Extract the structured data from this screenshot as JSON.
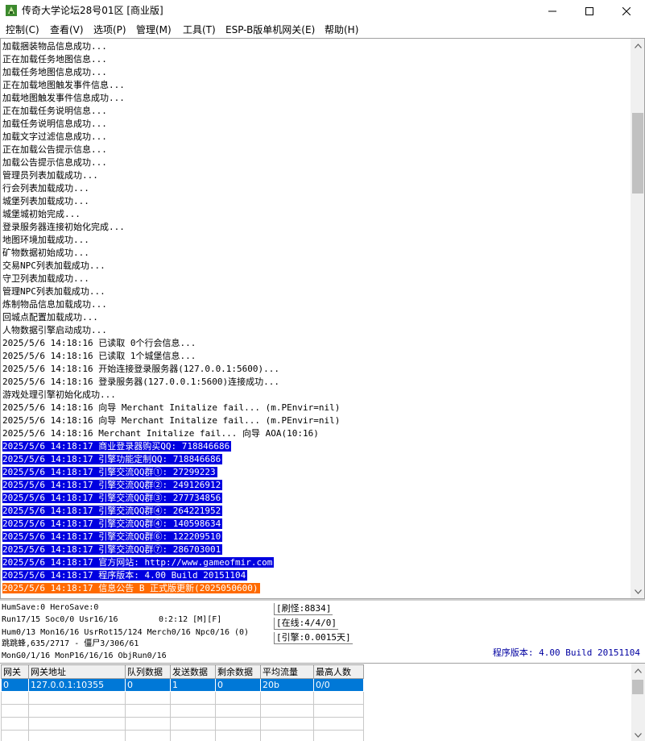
{
  "window": {
    "title": "传奇大学论坛28号01区 [商业版]"
  },
  "menu": [
    {
      "label": "控制(C)"
    },
    {
      "label": "查看(V)"
    },
    {
      "label": "选项(P)"
    },
    {
      "label": "管理(M)"
    },
    {
      "label": "工具(T)"
    },
    {
      "label": "ESP-B版单机网关(E)"
    },
    {
      "label": "帮助(H)"
    }
  ],
  "log": [
    {
      "text": "加载捆装物品信息成功..."
    },
    {
      "text": "正在加载任务地图信息..."
    },
    {
      "text": "加载任务地图信息成功..."
    },
    {
      "text": "正在加载地图触发事件信息..."
    },
    {
      "text": "加载地图触发事件信息成功..."
    },
    {
      "text": "正在加载任务说明信息..."
    },
    {
      "text": "加载任务说明信息成功..."
    },
    {
      "text": "加载文字过滤信息成功..."
    },
    {
      "text": "正在加载公告提示信息..."
    },
    {
      "text": "加载公告提示信息成功..."
    },
    {
      "text": "管理员列表加载成功..."
    },
    {
      "text": "行会列表加载成功..."
    },
    {
      "text": "城堡列表加载成功..."
    },
    {
      "text": "城堡城初始完成..."
    },
    {
      "text": "登录服务器连接初始化完成..."
    },
    {
      "text": "地图环境加载成功..."
    },
    {
      "text": "矿物数据初始成功..."
    },
    {
      "text": "交易NPC列表加载成功..."
    },
    {
      "text": "守卫列表加载成功..."
    },
    {
      "text": "管理NPC列表加载成功..."
    },
    {
      "text": "炼制物品信息加载成功..."
    },
    {
      "text": "回城点配置加载成功..."
    },
    {
      "text": "人物数据引擎启动成功..."
    },
    {
      "text": "2025/5/6 14:18:16 已读取 0个行会信息..."
    },
    {
      "text": "2025/5/6 14:18:16 已读取 1个城堡信息..."
    },
    {
      "text": "2025/5/6 14:18:16 开始连接登录服务器(127.0.0.1:5600)..."
    },
    {
      "text": "2025/5/6 14:18:16 登录服务器(127.0.0.1:5600)连接成功..."
    },
    {
      "text": "游戏处理引擎初始化成功..."
    },
    {
      "text": "2025/5/6 14:18:16 向导 Merchant Initalize fail... (m.PEnvir=nil)"
    },
    {
      "text": "2025/5/6 14:18:16 向导 Merchant Initalize fail... (m.PEnvir=nil)"
    },
    {
      "text": "2025/5/6 14:18:16 Merchant Initalize fail... 向导 AOA(10:16)"
    },
    {
      "text": "2025/5/6 14:18:17 商业登录器购买QQ: 718846686",
      "hl": "blue"
    },
    {
      "text": "2025/5/6 14:18:17 引擎功能定制QQ: 718846686",
      "hl": "blue"
    },
    {
      "text": "2025/5/6 14:18:17 引擎交流QQ群①: 27299223",
      "hl": "blue"
    },
    {
      "text": "2025/5/6 14:18:17 引擎交流QQ群②: 249126912",
      "hl": "blue"
    },
    {
      "text": "2025/5/6 14:18:17 引擎交流QQ群③: 277734856",
      "hl": "blue"
    },
    {
      "text": "2025/5/6 14:18:17 引擎交流QQ群④: 264221952",
      "hl": "blue"
    },
    {
      "text": "2025/5/6 14:18:17 引擎交流QQ群④: 140598634",
      "hl": "blue"
    },
    {
      "text": "2025/5/6 14:18:17 引擎交流QQ群⑥: 122209510",
      "hl": "blue"
    },
    {
      "text": "2025/5/6 14:18:17 引擎交流QQ群⑦: 286703001",
      "hl": "blue"
    },
    {
      "text": "2025/5/6 14:18:17 官方网站: http://www.gameofmir.com",
      "hl": "blue"
    },
    {
      "text": "2025/5/6 14:18:17 程序版本: 4.00 Build 20151104",
      "hl": "blue"
    },
    {
      "text": "2025/5/6 14:18:17 信息公告 B 正式版更新(2025050600)",
      "hl": "orange"
    }
  ],
  "status": {
    "line1": "HumSave:0 HeroSave:0",
    "line2": "Run17/15 Soc0/0 Usr16/16",
    "time": "0:2:12 [M][F]",
    "line3": "Hum0/13 Mon16/16 UsrRot15/124 Merch0/16 Npc0/16 (0)",
    "line4": "跳跳蜂,635/2717 - 僵尸3/306/61",
    "line5": "MonG0/1/16 MonP16/16/16 ObjRun0/16",
    "refresh": "[刷怪:8834]",
    "online": "[在线:4/4/0]",
    "engine": "[引擎:0.0015天]",
    "version": "程序版本: 4.00 Build 20151104"
  },
  "gateway": {
    "headers": [
      "网关",
      "网关地址",
      "队列数据",
      "发送数据",
      "剩余数据",
      "平均流量",
      "最高人数"
    ],
    "rows": [
      [
        "0",
        "127.0.0.1:10355",
        "0",
        "1",
        "0",
        "20b",
        "0/0"
      ]
    ]
  },
  "colors": {
    "highlight_blue": "#0000e0",
    "highlight_orange": "#ff6a00",
    "selection": "#0078d7"
  },
  "icons": {
    "app": "app-icon",
    "minimize": "minimize-icon",
    "maximize": "maximize-icon",
    "close": "close-icon"
  }
}
